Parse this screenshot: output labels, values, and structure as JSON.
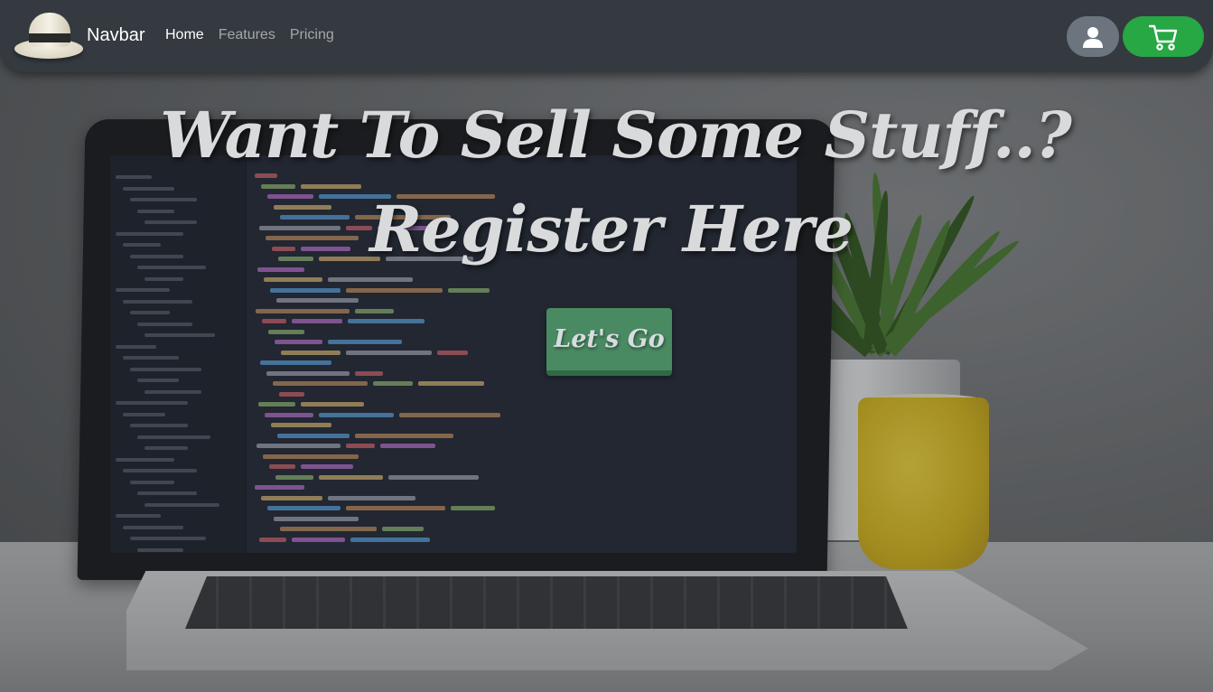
{
  "navbar": {
    "brand": "Navbar",
    "links": [
      {
        "label": "Home",
        "active": true
      },
      {
        "label": "Features",
        "active": false
      },
      {
        "label": "Pricing",
        "active": false
      }
    ],
    "user_icon": "user-icon",
    "cart_icon": "cart-icon"
  },
  "hero": {
    "line1": "Want To Sell Some Stuff..?",
    "line2": "Register Here",
    "cta": "Let's Go"
  },
  "colors": {
    "navbar_bg": "#343a40",
    "user_button": "#6c757d",
    "cart_button": "#28a745",
    "cta_button": "#4a8a62"
  }
}
